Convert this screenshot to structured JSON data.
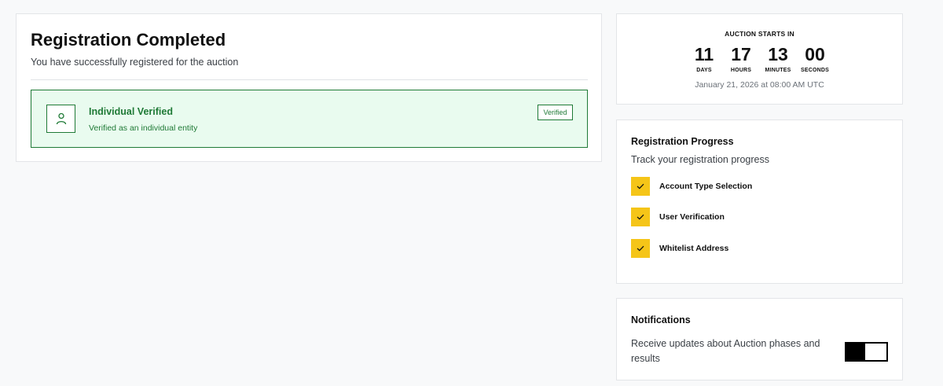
{
  "registration": {
    "title": "Registration Completed",
    "subtitle": "You have successfully registered for the auction",
    "verification": {
      "icon": "user-icon",
      "title": "Individual Verified",
      "subtitle": "Verified as an individual entity",
      "badge": "Verified"
    },
    "colors": {
      "success": "#1f7a36",
      "success_bg": "#e9fbef"
    }
  },
  "countdown": {
    "label": "AUCTION STARTS IN",
    "units": [
      {
        "value": "11",
        "caption": "DAYS"
      },
      {
        "value": "17",
        "caption": "HOURS"
      },
      {
        "value": "13",
        "caption": "MINUTES"
      },
      {
        "value": "00",
        "caption": "SECONDS"
      }
    ],
    "date": "January 21, 2026 at 08:00 AM UTC"
  },
  "progress": {
    "title": "Registration Progress",
    "subtitle": "Track your registration progress",
    "accent": "#f5c518",
    "steps": [
      {
        "label": "Account Type Selection",
        "completed": true,
        "icon": "check-icon"
      },
      {
        "label": "User Verification",
        "completed": true,
        "icon": "check-icon"
      },
      {
        "label": "Whitelist Address",
        "completed": true,
        "icon": "check-icon"
      }
    ]
  },
  "notifications": {
    "title": "Notifications",
    "description": "Receive updates about Auction phases and results",
    "toggle_on": true
  }
}
